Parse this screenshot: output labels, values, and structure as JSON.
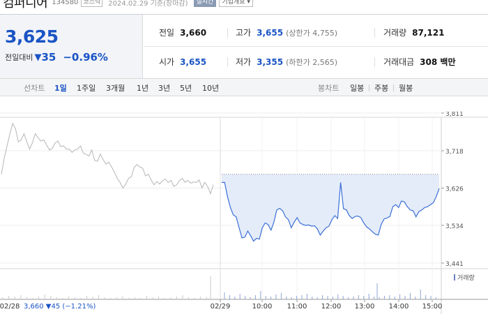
{
  "header": {
    "name": "컴퍼니어",
    "code": "134580",
    "market": "코스닥",
    "base_date": "2024.02.29  기준(장마감)",
    "realtime": "실시간",
    "company_info": "기업개요 ▾"
  },
  "summary": {
    "price": "3,625",
    "change_label": "전일대비",
    "change_arrow": "▼",
    "change_amount": "35",
    "change_pct": "−0.96%",
    "prev_close_label": "전일",
    "prev_close": "3,660",
    "high_label": "고가",
    "high": "3,655",
    "upper_limit": "(상한가 4,755)",
    "volume_label": "거래량",
    "volume": "87,121",
    "open_label": "시가",
    "open": "3,655",
    "low_label": "저가",
    "low": "3,355",
    "lower_limit": "(하한가 2,565)",
    "value_label": "거래대금",
    "value": "308 백만"
  },
  "toolbar": {
    "line_label": "선차트",
    "periods": [
      "1일",
      "1주일",
      "3개월",
      "1년",
      "3년",
      "5년",
      "10년"
    ],
    "active_period": "1일",
    "candle_label": "봉차트",
    "candles": [
      "일봉",
      "주봉",
      "월봉"
    ]
  },
  "colors": {
    "accent_blue": "#1a54c4",
    "today_line": "#3b6fd6",
    "today_fill": "#e4ecfa",
    "prev_line": "#b5b5b5"
  },
  "chart_data": {
    "type": "line",
    "yticks": [
      3811,
      3718,
      3626,
      3534,
      3441
    ],
    "ylim": [
      3441,
      3811
    ],
    "xticks": [
      "02/29",
      "10:00",
      "11:00",
      "12:00",
      "13:00",
      "14:00",
      "15:00"
    ],
    "prev_day_label": "02/28",
    "prev_day_info": "3,660 ▼45 (−1.21%)",
    "prev_close_ref": 3660,
    "volume_legend": "거래량",
    "series": [
      {
        "x": [
          0,
          2,
          4,
          6,
          8,
          10,
          12,
          14,
          16,
          18,
          20,
          22,
          24,
          26,
          28,
          30,
          32,
          34,
          36,
          38,
          40,
          42,
          44,
          46,
          48,
          50,
          52,
          54,
          56,
          58,
          60,
          62,
          64,
          66,
          68,
          70,
          72,
          74,
          76,
          78,
          80,
          82,
          84,
          86,
          88,
          90,
          92,
          94,
          96,
          98,
          100,
          102,
          104,
          106,
          108,
          110,
          112,
          114,
          116,
          118,
          120,
          122,
          124,
          126,
          128,
          130,
          132,
          134,
          136,
          138,
          140,
          142,
          144,
          146,
          148,
          150
        ],
        "values": [
          3660,
          3700,
          3730,
          3760,
          3785,
          3772,
          3740,
          3745,
          3760,
          3740,
          3722,
          3738,
          3760,
          3750,
          3742,
          3745,
          3732,
          3720,
          3724,
          3737,
          3742,
          3728,
          3730,
          3722,
          3722,
          3714,
          3720,
          3722,
          3730,
          3712,
          3709,
          3705,
          3720,
          3694,
          3692,
          3710,
          3696,
          3685,
          3690,
          3678,
          3665,
          3650,
          3640,
          3626,
          3636,
          3650,
          3654,
          3677,
          3684,
          3678,
          3675,
          3656,
          3660,
          3646,
          3634,
          3642,
          3636,
          3644,
          3648,
          3640,
          3645,
          3630,
          3634,
          3644,
          3650,
          3640,
          3645,
          3638,
          3641,
          3640,
          3646,
          3626,
          3640,
          3630,
          3612,
          3634
        ]
      },
      {
        "x": [
          0,
          2,
          4,
          6,
          8,
          10,
          12,
          14,
          16,
          18,
          20,
          22,
          24,
          26,
          28,
          30,
          32,
          34,
          36,
          38,
          40,
          42,
          44,
          46,
          48,
          50,
          52,
          54,
          56,
          58,
          60,
          62,
          64,
          66,
          68,
          70,
          72,
          74,
          76,
          78,
          80,
          82,
          84,
          86,
          88,
          90,
          92,
          94,
          96,
          98,
          100,
          102,
          104,
          106,
          108,
          110,
          112,
          114,
          116,
          118,
          120,
          122,
          124,
          126,
          128,
          130,
          132,
          134,
          136,
          138,
          140,
          142,
          144,
          146,
          148,
          150
        ],
        "values": [
          3640,
          3640,
          3605,
          3578,
          3560,
          3555,
          3528,
          3503,
          3505,
          3520,
          3508,
          3495,
          3502,
          3500,
          3528,
          3540,
          3536,
          3522,
          3542,
          3572,
          3576,
          3570,
          3555,
          3548,
          3528,
          3542,
          3553,
          3540,
          3536,
          3534,
          3535,
          3532,
          3533,
          3525,
          3510,
          3520,
          3528,
          3532,
          3548,
          3558,
          3551,
          3640,
          3575,
          3572,
          3558,
          3551,
          3556,
          3557,
          3553,
          3540,
          3530,
          3525,
          3518,
          3512,
          3510,
          3536,
          3550,
          3552,
          3556,
          3580,
          3585,
          3578,
          3594,
          3592,
          3580,
          3572,
          3570,
          3555,
          3568,
          3572,
          3578,
          3580,
          3585,
          3590,
          3605,
          3625
        ]
      }
    ]
  }
}
